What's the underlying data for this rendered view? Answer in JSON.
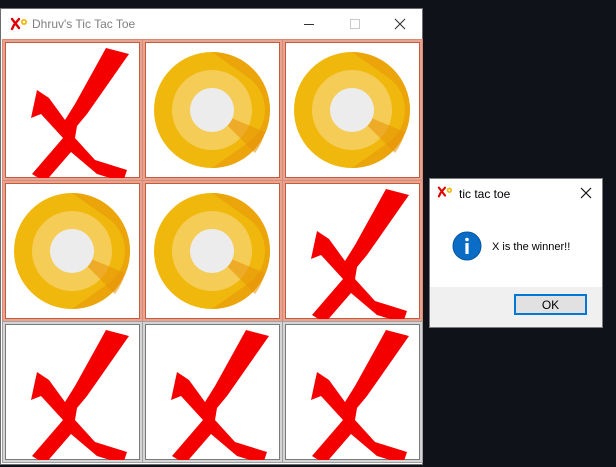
{
  "window": {
    "title": "Dhruv's Tic Tac Toe",
    "controls": [
      "minimize",
      "maximize",
      "close"
    ]
  },
  "board": {
    "cells": [
      "X",
      "O",
      "O",
      "O",
      "O",
      "X",
      "X",
      "X",
      "X"
    ],
    "highlighted": [
      true,
      true,
      true,
      true,
      true,
      true,
      false,
      false,
      false
    ]
  },
  "dialog": {
    "title": "tic tac toe",
    "message": "X is the winner!!",
    "ok_label": "OK",
    "icon": "info-icon"
  },
  "colors": {
    "x_mark": "#f40000",
    "o_outer": "#f0b80d",
    "o_shadow": "#e8940a",
    "o_inner_ring": "#f5cc55",
    "o_center": "#ececec",
    "info_blue": "#0a6cc4",
    "highlight_border": "#e8a493"
  }
}
